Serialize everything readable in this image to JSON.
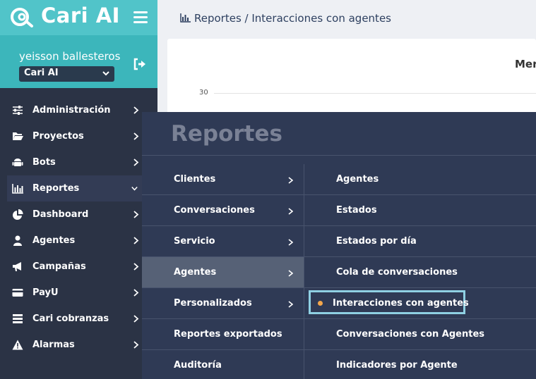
{
  "brand": {
    "name": "Cari AI"
  },
  "user": {
    "name": "yeisson ballesteros",
    "org_selected": "Cari AI"
  },
  "sidebar": {
    "items": [
      {
        "label": "Administración",
        "icon": "sliders-icon"
      },
      {
        "label": "Proyectos",
        "icon": "folder-open-icon"
      },
      {
        "label": "Bots",
        "icon": "android-icon"
      },
      {
        "label": "Reportes",
        "icon": "bar-chart-icon",
        "active": true
      },
      {
        "label": "Dashboard",
        "icon": "pie-chart-icon"
      },
      {
        "label": "Agentes",
        "icon": "user-icon"
      },
      {
        "label": "Campañas",
        "icon": "megaphone-icon"
      },
      {
        "label": "PayU",
        "icon": "credit-card-icon"
      },
      {
        "label": "Cari cobranzas",
        "icon": "list-icon"
      },
      {
        "label": "Alarmas",
        "icon": "warning-icon"
      }
    ]
  },
  "header": {
    "breadcrumb": "Reportes / Interacciones con agentes"
  },
  "chart_data": {
    "type": "line",
    "title": "Mer",
    "y_ticks": [
      "30"
    ]
  },
  "mega_menu": {
    "title": "Reportes",
    "categories": [
      {
        "label": "Clientes",
        "has_submenu": true
      },
      {
        "label": "Conversaciones",
        "has_submenu": true
      },
      {
        "label": "Servicio",
        "has_submenu": true
      },
      {
        "label": "Agentes",
        "has_submenu": true,
        "active": true
      },
      {
        "label": "Personalizados",
        "has_submenu": true
      },
      {
        "label": "Reportes exportados",
        "has_submenu": false
      },
      {
        "label": "Auditoría",
        "has_submenu": false
      }
    ],
    "subitems": [
      {
        "label": "Agentes"
      },
      {
        "label": "Estados"
      },
      {
        "label": "Estados por día"
      },
      {
        "label": "Cola de conversaciones"
      },
      {
        "label": "Interacciones con agentes",
        "current": true
      },
      {
        "label": "Conversaciones con Agentes"
      },
      {
        "label": "Indicadores por Agente"
      }
    ]
  },
  "colors": {
    "brand_teal": "#51c4c9",
    "sidebar_bg": "#2b3345",
    "menu_bg": "#2f3a55",
    "highlight_border": "#8fd0e3",
    "current_dot": "#f4a74b"
  }
}
